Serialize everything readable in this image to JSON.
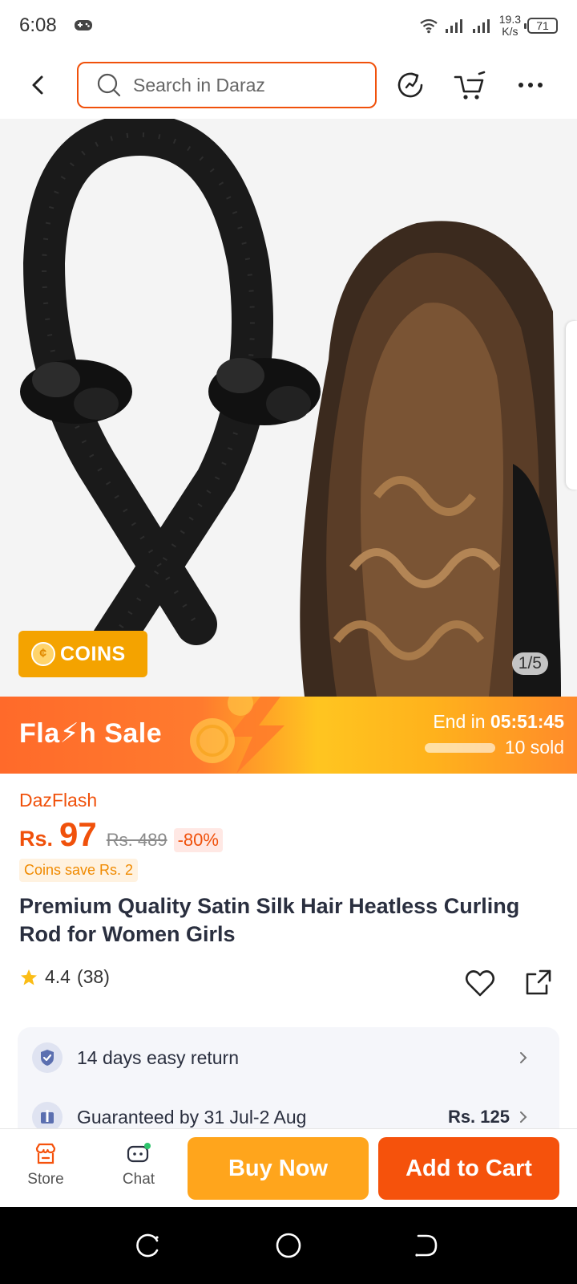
{
  "status_bar": {
    "time": "6:08",
    "net_speed_value": "19.3",
    "net_speed_unit": "K/s",
    "battery": "71",
    "icons": [
      "game-controller-icon",
      "wifi-icon",
      "signal-icon",
      "signal-icon",
      "battery-icon"
    ]
  },
  "header": {
    "search_placeholder": "Search in Daraz",
    "icons": [
      "back-arrow-icon",
      "search-icon",
      "refresh-icon",
      "cart-icon",
      "more-icon"
    ]
  },
  "gallery": {
    "coins_label": "COINS",
    "counter": "1/5"
  },
  "flash_sale": {
    "title": "Fla⚡h  Sale",
    "end_label": "End in",
    "countdown": "05:51:45",
    "sold": "10 sold"
  },
  "product": {
    "store_tag": "DazFlash",
    "currency": "Rs.",
    "price": "97",
    "original_price": "Rs. 489",
    "discount": "-80%",
    "coins_save": "Coins save Rs. 2",
    "title": "Premium Quality Satin Silk Hair Heatless Curling Rod for Women Girls",
    "rating": "4.4",
    "reviews": "(38)"
  },
  "services": {
    "return_text": "14 days easy return",
    "guarantee_text": "Guaranteed by 31 Jul-2 Aug",
    "delivery_fee": "Rs. 125"
  },
  "bottom_bar": {
    "store_label": "Store",
    "chat_label": "Chat",
    "buy_now": "Buy Now",
    "add_to_cart": "Add to Cart"
  },
  "colors": {
    "accent": "#f0510b",
    "buy_now": "#ffa51c",
    "add_to_cart": "#f5520c",
    "coins_badge": "#f4a300"
  }
}
